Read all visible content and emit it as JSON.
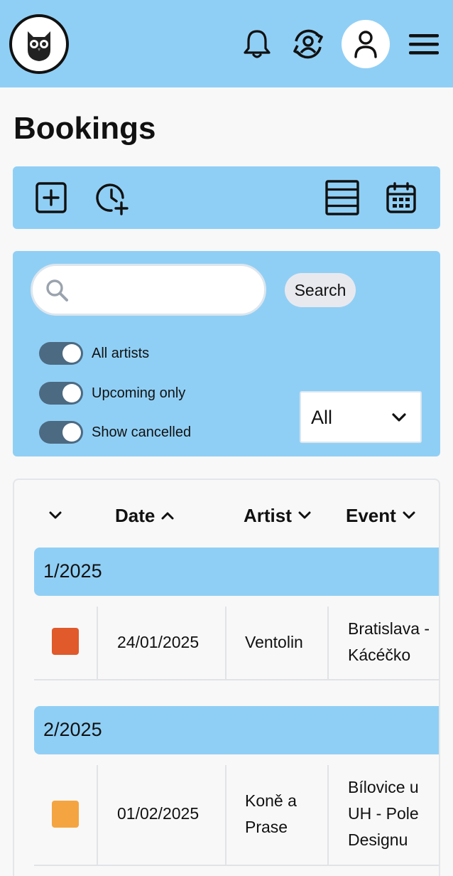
{
  "page": {
    "title": "Bookings"
  },
  "header": {
    "logo_icon": "owl-logo-icon",
    "icons": [
      "bell-icon",
      "user-sync-icon",
      "user-avatar-icon",
      "hamburger-menu-icon"
    ]
  },
  "toolbar": {
    "icons": [
      "add-booking-icon",
      "add-time-icon",
      "list-view-icon",
      "calendar-view-icon"
    ]
  },
  "filters": {
    "search_placeholder": "",
    "search_value": "",
    "search_button": "Search",
    "toggles": [
      {
        "label": "All artists",
        "on": true
      },
      {
        "label": "Upcoming only",
        "on": true
      },
      {
        "label": "Show cancelled",
        "on": true
      }
    ],
    "select_value": "All"
  },
  "table": {
    "columns": [
      "",
      "Date",
      "Artist",
      "Event"
    ],
    "groups": [
      {
        "label": "1/2025",
        "rows": [
          {
            "color": "#e05a2b",
            "date": "24/01/2025",
            "artist": "Ventolin",
            "event": "Bratislava - Kácéčko"
          }
        ]
      },
      {
        "label": "2/2025",
        "rows": [
          {
            "color": "#f4a541",
            "date": "01/02/2025",
            "artist": "Koně a Prase",
            "event": "Bílovice u UH - Pole Designu"
          }
        ]
      }
    ]
  },
  "colors": {
    "accent": "#90cff5",
    "toggle": "#4c6a82",
    "background": "#f8f8f8"
  }
}
